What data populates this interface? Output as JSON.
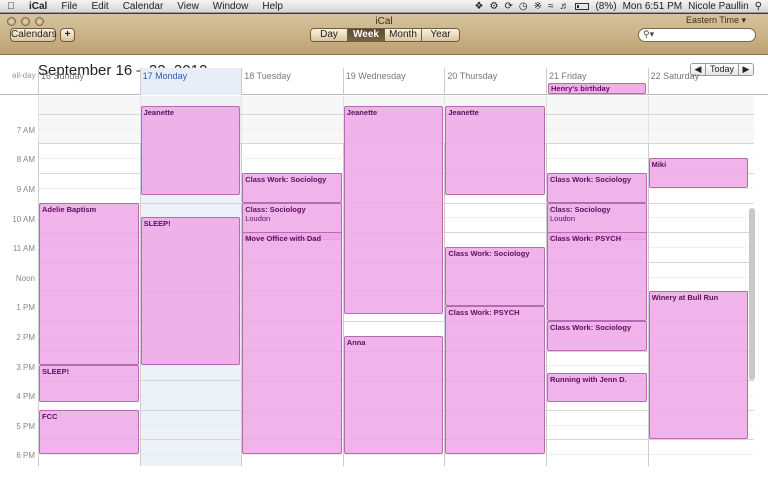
{
  "menubar": {
    "apple": "",
    "app_name": "iCal",
    "menus": [
      "File",
      "Edit",
      "Calendar",
      "View",
      "Window",
      "Help"
    ],
    "battery": "(8%)",
    "clock": "Mon 6:51 PM",
    "user": "Nicole Paullin"
  },
  "window": {
    "title": "iCal",
    "calendars_label": "Calendars",
    "add_label": "+",
    "views": [
      "Day",
      "Week",
      "Month",
      "Year"
    ],
    "active_view": "Week",
    "timezone": "Eastern Time ▾",
    "search_placeholder": ""
  },
  "header": {
    "week_title": "September 16 – 22, 2012",
    "prev": "◀",
    "today": "Today",
    "next": "▶"
  },
  "allday_label": "all-day",
  "days": [
    {
      "num": "16",
      "name": "Sunday"
    },
    {
      "num": "17",
      "name": "Monday",
      "today": true
    },
    {
      "num": "18",
      "name": "Tuesday"
    },
    {
      "num": "19",
      "name": "Wednesday"
    },
    {
      "num": "20",
      "name": "Thursday"
    },
    {
      "num": "21",
      "name": "Friday"
    },
    {
      "num": "22",
      "name": "Saturday"
    }
  ],
  "time_labels": [
    "7 AM",
    "8 AM",
    "9 AM",
    "10 AM",
    "11 AM",
    "Noon",
    "1 PM",
    "2 PM",
    "3 PM",
    "4 PM",
    "5 PM",
    "6 PM"
  ],
  "allday_events": [
    {
      "day": 5,
      "title": "Henry's birthday"
    }
  ],
  "events": [
    {
      "day": 0,
      "start": 10.0,
      "end": 15.5,
      "title": "Adelie Baptism"
    },
    {
      "day": 0,
      "start": 15.5,
      "end": 16.75,
      "title": "SLEEP!"
    },
    {
      "day": 0,
      "start": 17.0,
      "end": 18.5,
      "title": "FCC"
    },
    {
      "day": 1,
      "start": 6.75,
      "end": 9.75,
      "title": "Jeanette"
    },
    {
      "day": 1,
      "start": 10.5,
      "end": 15.5,
      "title": "SLEEP!"
    },
    {
      "day": 2,
      "start": 9.0,
      "end": 10.0,
      "title": "Class Work: Sociology"
    },
    {
      "day": 2,
      "start": 10.0,
      "end": 11.25,
      "title": "Class: Sociology",
      "loc": "Loudon"
    },
    {
      "day": 2,
      "start": 11.0,
      "end": 18.5,
      "title": "Move Office with Dad"
    },
    {
      "day": 3,
      "start": 6.75,
      "end": 13.75,
      "title": "Jeanette"
    },
    {
      "day": 3,
      "start": 14.5,
      "end": 18.5,
      "title": "Anna"
    },
    {
      "day": 4,
      "start": 6.75,
      "end": 9.75,
      "title": "Jeanette"
    },
    {
      "day": 4,
      "start": 11.5,
      "end": 13.5,
      "title": "Class Work: Sociology"
    },
    {
      "day": 4,
      "start": 13.5,
      "end": 18.5,
      "title": "Class Work: PSYCH"
    },
    {
      "day": 5,
      "start": 9.0,
      "end": 10.0,
      "title": "Class Work: Sociology"
    },
    {
      "day": 5,
      "start": 10.0,
      "end": 11.25,
      "title": "Class: Sociology",
      "loc": "Loudon"
    },
    {
      "day": 5,
      "start": 11.0,
      "end": 14.0,
      "title": "Class Work: PSYCH"
    },
    {
      "day": 5,
      "start": 14.0,
      "end": 15.0,
      "title": "Class Work: Sociology"
    },
    {
      "day": 5,
      "start": 15.75,
      "end": 16.75,
      "title": "Running with Jenn D."
    },
    {
      "day": 6,
      "start": 8.5,
      "end": 9.5,
      "title": "Miki"
    },
    {
      "day": 6,
      "start": 13.0,
      "end": 18.0,
      "title": "Winery at Bull Run"
    }
  ]
}
